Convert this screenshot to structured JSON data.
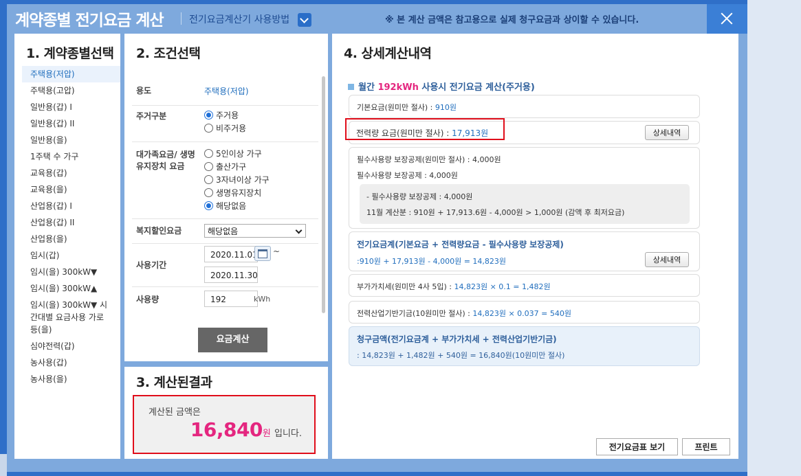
{
  "header": {
    "title": "계약종별 전기요금 계산",
    "howto_label": "전기요금계산기 사용방법",
    "notice": "※ 본 계산 금액은 참고용으로 실제 청구요금과 상이할 수 있습니다."
  },
  "section1": {
    "title": "1. 계약종별선택",
    "items": [
      "주택용(저압)",
      "주택용(고압)",
      "일반용(갑) I",
      "일반용(갑) II",
      "일반용(을)",
      "1주택 수 가구",
      "교육용(갑)",
      "교육용(을)",
      "산업용(갑) I",
      "산업용(갑) II",
      "산업용(을)",
      "임시(갑)",
      "임시(을) 300kW▼",
      "임시(을) 300kW▲",
      "임시(을) 300kW▼ 시간대별 요금사용 가로등(을)",
      "심야전력(갑)",
      "농사용(갑)",
      "농사용(을)"
    ],
    "selected": "주택용(저압)"
  },
  "section2": {
    "title": "2. 조건선택",
    "usage_label": "용도",
    "usage_value": "주택용(저압)",
    "residence_label": "주거구분",
    "residence_options": [
      "주거용",
      "비주거용"
    ],
    "residence_selected": "주거용",
    "discount_label": "대가족요금/ 생명유지장치 요금",
    "discount_options": [
      "5인이상 가구",
      "출산가구",
      "3자녀이상 가구",
      "생명유지장치",
      "해당없음"
    ],
    "discount_selected": "해당없음",
    "welfare_label": "복지할인요금",
    "welfare_value": "해당없음",
    "period_label": "사용기간",
    "period_start": "2020.11.01",
    "period_tilde": "~",
    "period_end": "2020.11.30",
    "amount_label": "사용량",
    "amount_value": "192",
    "amount_unit": "kWh",
    "calc_button": "요금계산"
  },
  "section3": {
    "title": "3. 계산된결과",
    "label": "계산된 금액은",
    "amount": "16,840",
    "unit": "원",
    "suffix": "입니다."
  },
  "section4": {
    "title": "4. 상세계산내역",
    "subtitle_pre": "월간",
    "subtitle_kwh": "192kWh",
    "subtitle_post": "사용시 전기요금 계산(주거용)",
    "base_label": "기본요금(원미만 절사) :",
    "base_value": "910원",
    "energy_label": "전력량 요금(원미만 절사) :",
    "energy_value": "17,913원",
    "detail_button": "상세내역",
    "essential_line1": "필수사용량 보장공제(원미만 절사) : 4,000원",
    "essential_line2": "필수사용량 보장공제 : 4,000원",
    "essential_inner1": "- 필수사용량 보장공제 : 4,000원",
    "essential_inner2": "11월 계산분 : 910원 + 17,913.6원  - 4,000원 > 1,000원 (감액 후 최저요금)",
    "total_title": "전기요금계(기본요금 + 전력량요금 - 필수사용량 보장공제)",
    "total_calc": ":910원 + 17,913원 - 4,000원 = 14,823원",
    "vat_label": "부가가치세(원미만 4사 5입) :",
    "vat_value": "14,823원 × 0.1 = 1,482원",
    "fund_label": "전력산업기반기금(10원미만 절사) :",
    "fund_value": "14,823원 × 0.037 = 540원",
    "bill_title": "청구금액(전기요금계 + 부가가치세 + 전력산업기반기금)",
    "bill_calc": ": 14,823원 + 1,482원 + 540원 = 16,840원(10원미만 절사)",
    "rate_button": "전기요금표 보기",
    "print_button": "프린트"
  }
}
